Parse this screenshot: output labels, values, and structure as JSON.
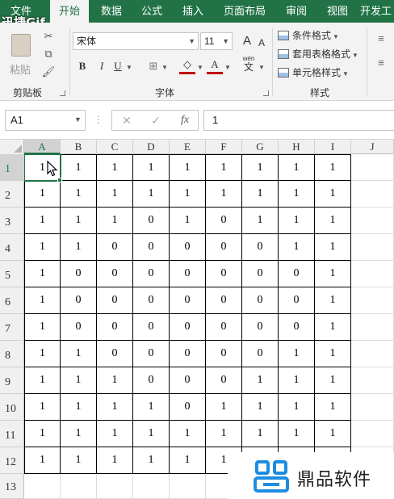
{
  "watermark_top": "迅捷Gif",
  "tabs": [
    "文件",
    "开始",
    "数据",
    "公式",
    "插入",
    "页面布局",
    "审阅",
    "视图",
    "开发工"
  ],
  "ribbon": {
    "clipboard": {
      "paste_label": "粘贴",
      "group_label": "剪贴板"
    },
    "font": {
      "font_name": "宋体",
      "font_size": "11",
      "bold": "B",
      "italic": "I",
      "underline": "U",
      "grow": "A",
      "shrink": "A",
      "phonetic": "wén",
      "phonetic_char": "文",
      "group_label": "字体"
    },
    "styles": {
      "conditional": "条件格式",
      "table": "套用表格格式",
      "cell_styles": "单元格样式",
      "group_label": "样式"
    }
  },
  "formula_bar": {
    "name_box": "A1",
    "fx": "fx",
    "cancel": "✕",
    "enter": "✓",
    "content": "1"
  },
  "sheet": {
    "columns": [
      "A",
      "B",
      "C",
      "D",
      "E",
      "F",
      "G",
      "H",
      "I",
      "J"
    ],
    "rows": [
      "1",
      "2",
      "3",
      "4",
      "5",
      "6",
      "7",
      "8",
      "9",
      "10",
      "11",
      "12",
      "13"
    ],
    "selected_cell": "A1",
    "values": [
      [
        "1",
        "1",
        "1",
        "1",
        "1",
        "1",
        "1",
        "1",
        "1"
      ],
      [
        "1",
        "1",
        "1",
        "1",
        "1",
        "1",
        "1",
        "1",
        "1"
      ],
      [
        "1",
        "1",
        "1",
        "0",
        "1",
        "0",
        "1",
        "1",
        "1"
      ],
      [
        "1",
        "1",
        "0",
        "0",
        "0",
        "0",
        "0",
        "1",
        "1"
      ],
      [
        "1",
        "0",
        "0",
        "0",
        "0",
        "0",
        "0",
        "0",
        "1"
      ],
      [
        "1",
        "0",
        "0",
        "0",
        "0",
        "0",
        "0",
        "0",
        "1"
      ],
      [
        "1",
        "0",
        "0",
        "0",
        "0",
        "0",
        "0",
        "0",
        "1"
      ],
      [
        "1",
        "1",
        "0",
        "0",
        "0",
        "0",
        "0",
        "1",
        "1"
      ],
      [
        "1",
        "1",
        "1",
        "0",
        "0",
        "0",
        "1",
        "1",
        "1"
      ],
      [
        "1",
        "1",
        "1",
        "1",
        "0",
        "1",
        "1",
        "1",
        "1"
      ],
      [
        "1",
        "1",
        "1",
        "1",
        "1",
        "1",
        "1",
        "1",
        "1"
      ],
      [
        "1",
        "1",
        "1",
        "1",
        "1",
        "1",
        "",
        "",
        ""
      ]
    ]
  },
  "logo_text": "鼎品软件",
  "colors": {
    "excel_green": "#217346",
    "logo_blue": "#1d8de0"
  }
}
